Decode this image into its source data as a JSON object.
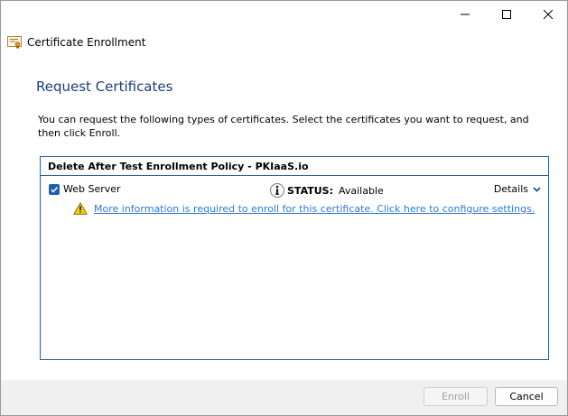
{
  "header": {
    "title": "Certificate Enrollment",
    "icon": "certificate-icon"
  },
  "window_controls": {
    "minimize": "minimize-icon",
    "maximize": "maximize-icon",
    "close": "close-icon"
  },
  "page": {
    "title": "Request Certificates",
    "description": "You can request the following types of certificates. Select the certificates you want to request, and then click Enroll."
  },
  "policy": {
    "name": "Delete After Test Enrollment Policy - PKIaaS.io",
    "certificates": [
      {
        "name": "Web Server",
        "checked": true,
        "status_label": "STATUS:",
        "status_value": "Available",
        "details_label": "Details",
        "warning_link": "More information is required to enroll for this certificate. Click here to configure settings."
      }
    ]
  },
  "footer": {
    "enroll_label": "Enroll",
    "enroll_enabled": false,
    "cancel_label": "Cancel"
  },
  "colors": {
    "title_blue": "#1e3c78",
    "border_blue": "#2d5f9e",
    "link_blue": "#2c7bd6",
    "checkbox_blue": "#1f5fb0",
    "warning_yellow": "#f5d000"
  }
}
